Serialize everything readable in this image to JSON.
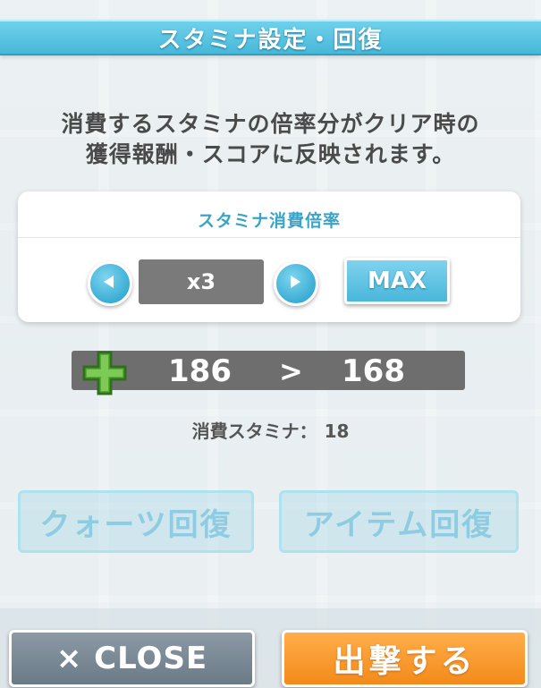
{
  "dialog": {
    "title": "スタミナ設定・回復",
    "description_line1": "消費するスタミナの倍率分がクリア時の",
    "description_line2": "獲得報酬・スコアに反映されます。"
  },
  "multiplier": {
    "label": "スタミナ消費倍率",
    "value": "x3",
    "max_label": "MAX"
  },
  "stamina": {
    "current": "186",
    "arrow": ">",
    "after": "168",
    "consume_label": "消費スタミナ：",
    "consume_value": "18"
  },
  "recovery": {
    "quartz_label": "クォーツ回復",
    "item_label": "アイテム回復"
  },
  "footer": {
    "close_label": "× CLOSE",
    "sortie_label": "出撃する"
  },
  "colors": {
    "accent": "#47b8d9",
    "sortie": "#f38a1a",
    "close": "#6a7a86"
  },
  "icons": [
    "chevron-left-icon",
    "chevron-right-icon",
    "plus-icon"
  ]
}
